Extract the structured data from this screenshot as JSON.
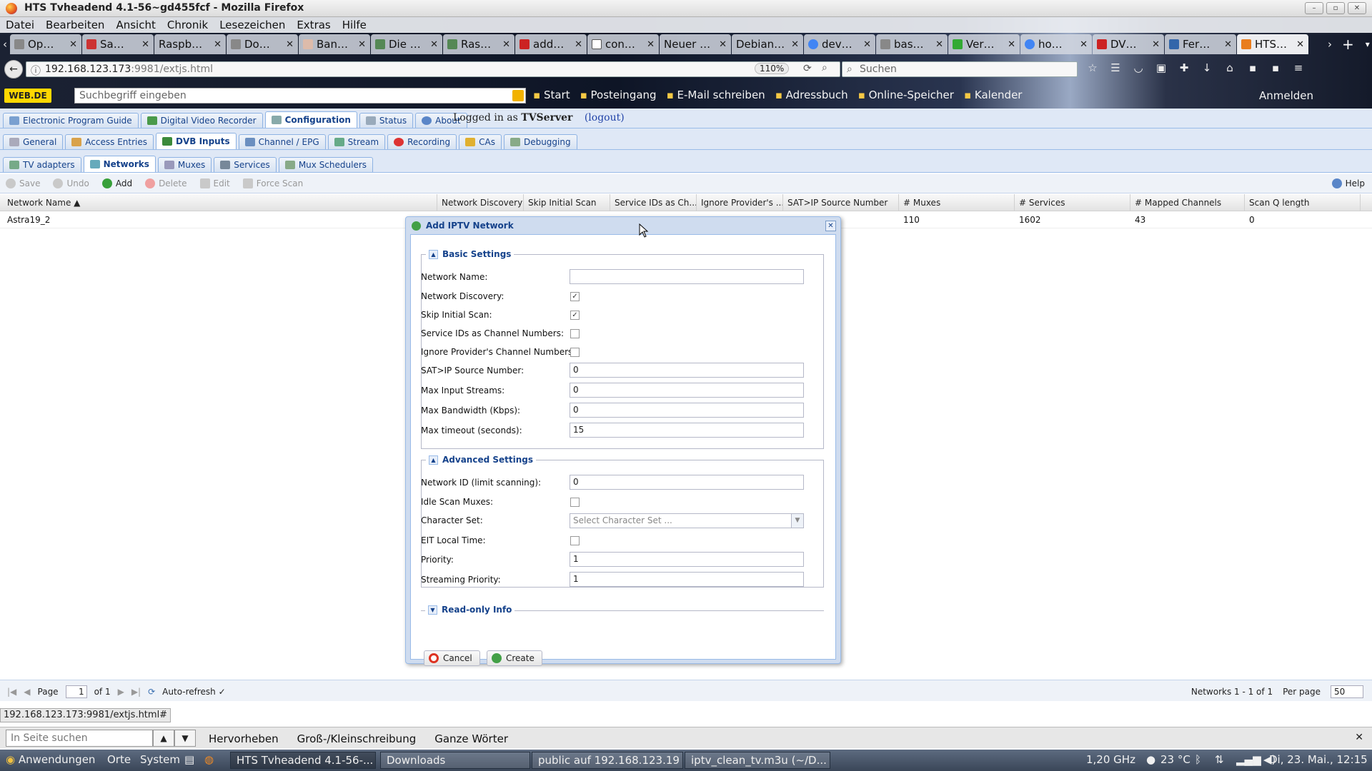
{
  "window": {
    "title": "HTS Tvheadend 4.1-56~gd455fcf - Mozilla Firefox"
  },
  "menu": [
    "Datei",
    "Bearbeiten",
    "Ansicht",
    "Chronik",
    "Lesezeichen",
    "Extras",
    "Hilfe"
  ],
  "tabs": [
    "Op…",
    "Sa…",
    "Raspb…",
    "Do…",
    "Ban…",
    "Die …",
    "Ras…",
    "add…",
    "con…",
    "Neuer …",
    "Debian…",
    "dev…",
    "bas…",
    "Ver…",
    "ho…",
    "DV…",
    "Fer…",
    "HTS…"
  ],
  "url": {
    "host": "192.168.123.173",
    "rest": ":9981/extjs.html",
    "zoom": "110%",
    "search_placeholder": "Suchen"
  },
  "webde": {
    "logo": "WEB.DE",
    "search_placeholder": "Suchbegriff eingeben",
    "bookmarks": [
      "Start",
      "Posteingang",
      "E-Mail schreiben",
      "Adressbuch",
      "Online-Speicher",
      "Kalender"
    ],
    "login": "Anmelden"
  },
  "app": {
    "main_tabs": [
      "Electronic Program Guide",
      "Digital Video Recorder",
      "Configuration",
      "Status",
      "About"
    ],
    "logged_prefix": "Logged in as",
    "logged_user": "TVServer",
    "logout": "(logout)",
    "config_tabs": [
      "General",
      "Access Entries",
      "DVB Inputs",
      "Channel / EPG",
      "Stream",
      "Recording",
      "CAs",
      "Debugging"
    ],
    "dvb_tabs": [
      "TV adapters",
      "Networks",
      "Muxes",
      "Services",
      "Mux Schedulers"
    ],
    "toolbar": {
      "save": "Save",
      "undo": "Undo",
      "add": "Add",
      "delete": "Delete",
      "edit": "Edit",
      "force_scan": "Force Scan",
      "help": "Help"
    },
    "columns": [
      "Network Name ▲",
      "Network Discovery",
      "Skip Initial Scan",
      "Service IDs as Ch...",
      "Ignore Provider's ...",
      "SAT>IP Source Number",
      "# Muxes",
      "# Services",
      "# Mapped Channels",
      "Scan Q length"
    ],
    "row": {
      "name": "Astra19_2",
      "muxes": "110",
      "services": "1602",
      "mapped": "43",
      "scanq": "0"
    },
    "pager": {
      "page_label": "Page",
      "page": "1",
      "of": "of 1",
      "auto_refresh": "Auto-refresh ✓",
      "summary": "Networks 1 - 1 of 1",
      "per_page_label": "Per page",
      "per_page": "50"
    }
  },
  "dialog": {
    "title": "Add IPTV Network",
    "basic_legend": "Basic Settings",
    "advanced_legend": "Advanced Settings",
    "readonly_legend": "Read-only Info",
    "labels": {
      "network_name": "Network Name:",
      "network_discovery": "Network Discovery:",
      "skip_initial_scan": "Skip Initial Scan:",
      "service_ids": "Service IDs as Channel Numbers:",
      "ignore_provider": "Ignore Provider's Channel Numbers:",
      "satip_source": "SAT>IP Source Number:",
      "max_input": "Max Input Streams:",
      "max_bandwidth": "Max Bandwidth (Kbps):",
      "max_timeout": "Max timeout (seconds):",
      "network_id": "Network ID (limit scanning):",
      "idle_scan": "Idle Scan Muxes:",
      "charset": "Character Set:",
      "eit_local": "EIT Local Time:",
      "priority": "Priority:",
      "streaming_priority": "Streaming Priority:"
    },
    "values": {
      "network_name": "",
      "satip_source": "0",
      "max_input": "0",
      "max_bandwidth": "0",
      "max_timeout": "15",
      "network_id": "0",
      "charset_placeholder": "Select Character Set ...",
      "priority": "1",
      "streaming_priority": "1"
    },
    "checks": {
      "network_discovery": true,
      "skip_initial_scan": true,
      "service_ids": false,
      "ignore_provider": false,
      "idle_scan": false,
      "eit_local": false
    },
    "cancel": "Cancel",
    "create": "Create"
  },
  "status_url": "192.168.123.173:9981/extjs.html#",
  "findbar": {
    "placeholder": "In Seite suchen",
    "highlight": "Hervorheben",
    "case": "Groß-/Kleinschreibung",
    "whole": "Ganze Wörter"
  },
  "taskbar": {
    "menus": [
      "Anwendungen",
      "Orte",
      "System"
    ],
    "windows": [
      "HTS Tvheadend 4.1-56-...",
      "Downloads",
      "public auf 192.168.123.19",
      "iptv_clean_tv.m3u (~/D..."
    ],
    "cpu": "1,20 GHz",
    "temp": "23 °C",
    "clock": "Di, 23. Mai., 12:15"
  }
}
